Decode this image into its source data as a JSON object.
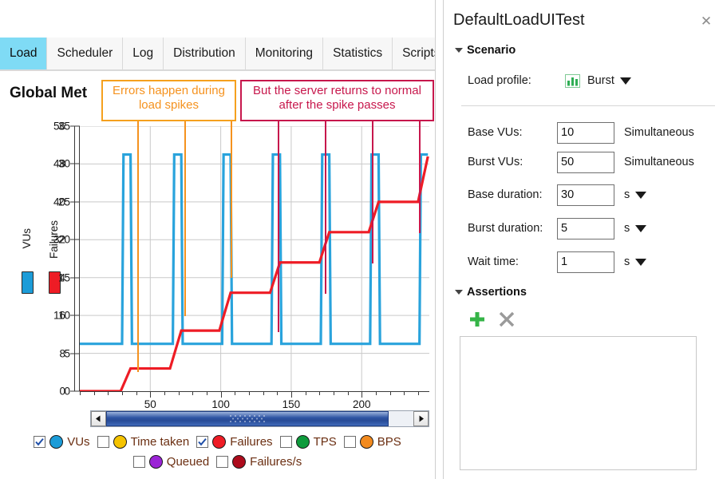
{
  "tabs": [
    {
      "label": "Load",
      "active": true
    },
    {
      "label": "Scheduler",
      "active": false
    },
    {
      "label": "Log",
      "active": false
    },
    {
      "label": "Distribution",
      "active": false
    },
    {
      "label": "Monitoring",
      "active": false
    },
    {
      "label": "Statistics",
      "active": false
    },
    {
      "label": "Scripts",
      "active": false
    }
  ],
  "chart": {
    "title": "Global Met",
    "annotations": [
      {
        "id": "errors",
        "text": "Errors happen during load spikes",
        "color": "#F5921E",
        "border": "#F5A01E"
      },
      {
        "id": "normal",
        "text": "But the server returns to normal after the spike passes",
        "color": "#C7174C",
        "border": "#C7174C"
      }
    ]
  },
  "chart_data": {
    "type": "line",
    "title": "Global Met",
    "xlabel": "",
    "xlim": [
      0,
      248
    ],
    "xticks": [
      50,
      100,
      150,
      200
    ],
    "grid": true,
    "legend_position": "bottom",
    "axes": [
      {
        "name": "VUs",
        "color": "#29A3DC",
        "ylim": [
          0,
          56
        ],
        "yticks": [
          0,
          8,
          16,
          24,
          32,
          40,
          48,
          56
        ],
        "side": "left"
      },
      {
        "name": "Failures",
        "color": "#EE1C25",
        "ylim": [
          0,
          35
        ],
        "yticks": [
          0,
          5,
          10,
          15,
          20,
          25,
          30,
          35
        ],
        "side": "left-inner"
      }
    ],
    "series": [
      {
        "name": "VUs",
        "color": "#29A3DC",
        "axis": "VUs",
        "description": "Square-wave burst load: base 10 VUs with periodic bursts to 50 VUs",
        "base_value": 10,
        "burst_value": 50,
        "points": [
          [
            0,
            10
          ],
          [
            30,
            10
          ],
          [
            31,
            50
          ],
          [
            36,
            50
          ],
          [
            37,
            10
          ],
          [
            66,
            10
          ],
          [
            67,
            50
          ],
          [
            72,
            50
          ],
          [
            73,
            10
          ],
          [
            101,
            10
          ],
          [
            102,
            50
          ],
          [
            107,
            50
          ],
          [
            108,
            10
          ],
          [
            136,
            10
          ],
          [
            137,
            50
          ],
          [
            142,
            50
          ],
          [
            143,
            10
          ],
          [
            171,
            10
          ],
          [
            172,
            50
          ],
          [
            177,
            50
          ],
          [
            178,
            10
          ],
          [
            206,
            10
          ],
          [
            207,
            50
          ],
          [
            212,
            50
          ],
          [
            213,
            10
          ],
          [
            241,
            10
          ],
          [
            242,
            50
          ],
          [
            247,
            50
          ]
        ]
      },
      {
        "name": "Failures",
        "color": "#EE1C25",
        "axis": "Failures",
        "description": "Cumulative failures, stepping up during each load spike",
        "points": [
          [
            0,
            0
          ],
          [
            29,
            0
          ],
          [
            36,
            3
          ],
          [
            64,
            3
          ],
          [
            72,
            8
          ],
          [
            99,
            8
          ],
          [
            107,
            13
          ],
          [
            135,
            13
          ],
          [
            142,
            17
          ],
          [
            170,
            17
          ],
          [
            177,
            21
          ],
          [
            205,
            21
          ],
          [
            212,
            25
          ],
          [
            240,
            25
          ],
          [
            247,
            31
          ]
        ]
      }
    ],
    "legend": [
      {
        "label": "VUs",
        "color": "#1C9CD8",
        "checked": true
      },
      {
        "label": "Time taken",
        "color": "#F5C300",
        "checked": false
      },
      {
        "label": "Failures",
        "color": "#EE1C25",
        "checked": true
      },
      {
        "label": "TPS",
        "color": "#0E9B3C",
        "checked": false
      },
      {
        "label": "BPS",
        "color": "#F28A1E",
        "checked": false
      },
      {
        "label": "Queued",
        "color": "#9B24D6",
        "checked": false
      },
      {
        "label": "Failures/s",
        "color": "#AD0B1C",
        "checked": false
      }
    ]
  },
  "scrollbar": {
    "left_arrow": "◀",
    "right_arrow": "▶"
  },
  "panel": {
    "title": "DefaultLoadUITest",
    "close_label": "✕",
    "scenario": {
      "heading": "Scenario",
      "load_profile_label": "Load profile:",
      "load_profile_value": "Burst",
      "fields": [
        {
          "label": "Base VUs:",
          "value": "10",
          "suffix": "Simultaneous",
          "has_dropdown": false
        },
        {
          "label": "Burst VUs:",
          "value": "50",
          "suffix": "Simultaneous",
          "has_dropdown": false
        },
        {
          "label": "Base duration:",
          "value": "30",
          "suffix": "s",
          "has_dropdown": true
        },
        {
          "label": "Burst duration:",
          "value": "5",
          "suffix": "s",
          "has_dropdown": true
        },
        {
          "label": "Wait time:",
          "value": "1",
          "suffix": "s",
          "has_dropdown": true
        }
      ]
    },
    "assertions": {
      "heading": "Assertions",
      "add_label": "+",
      "remove_label": "✕",
      "items": []
    }
  }
}
